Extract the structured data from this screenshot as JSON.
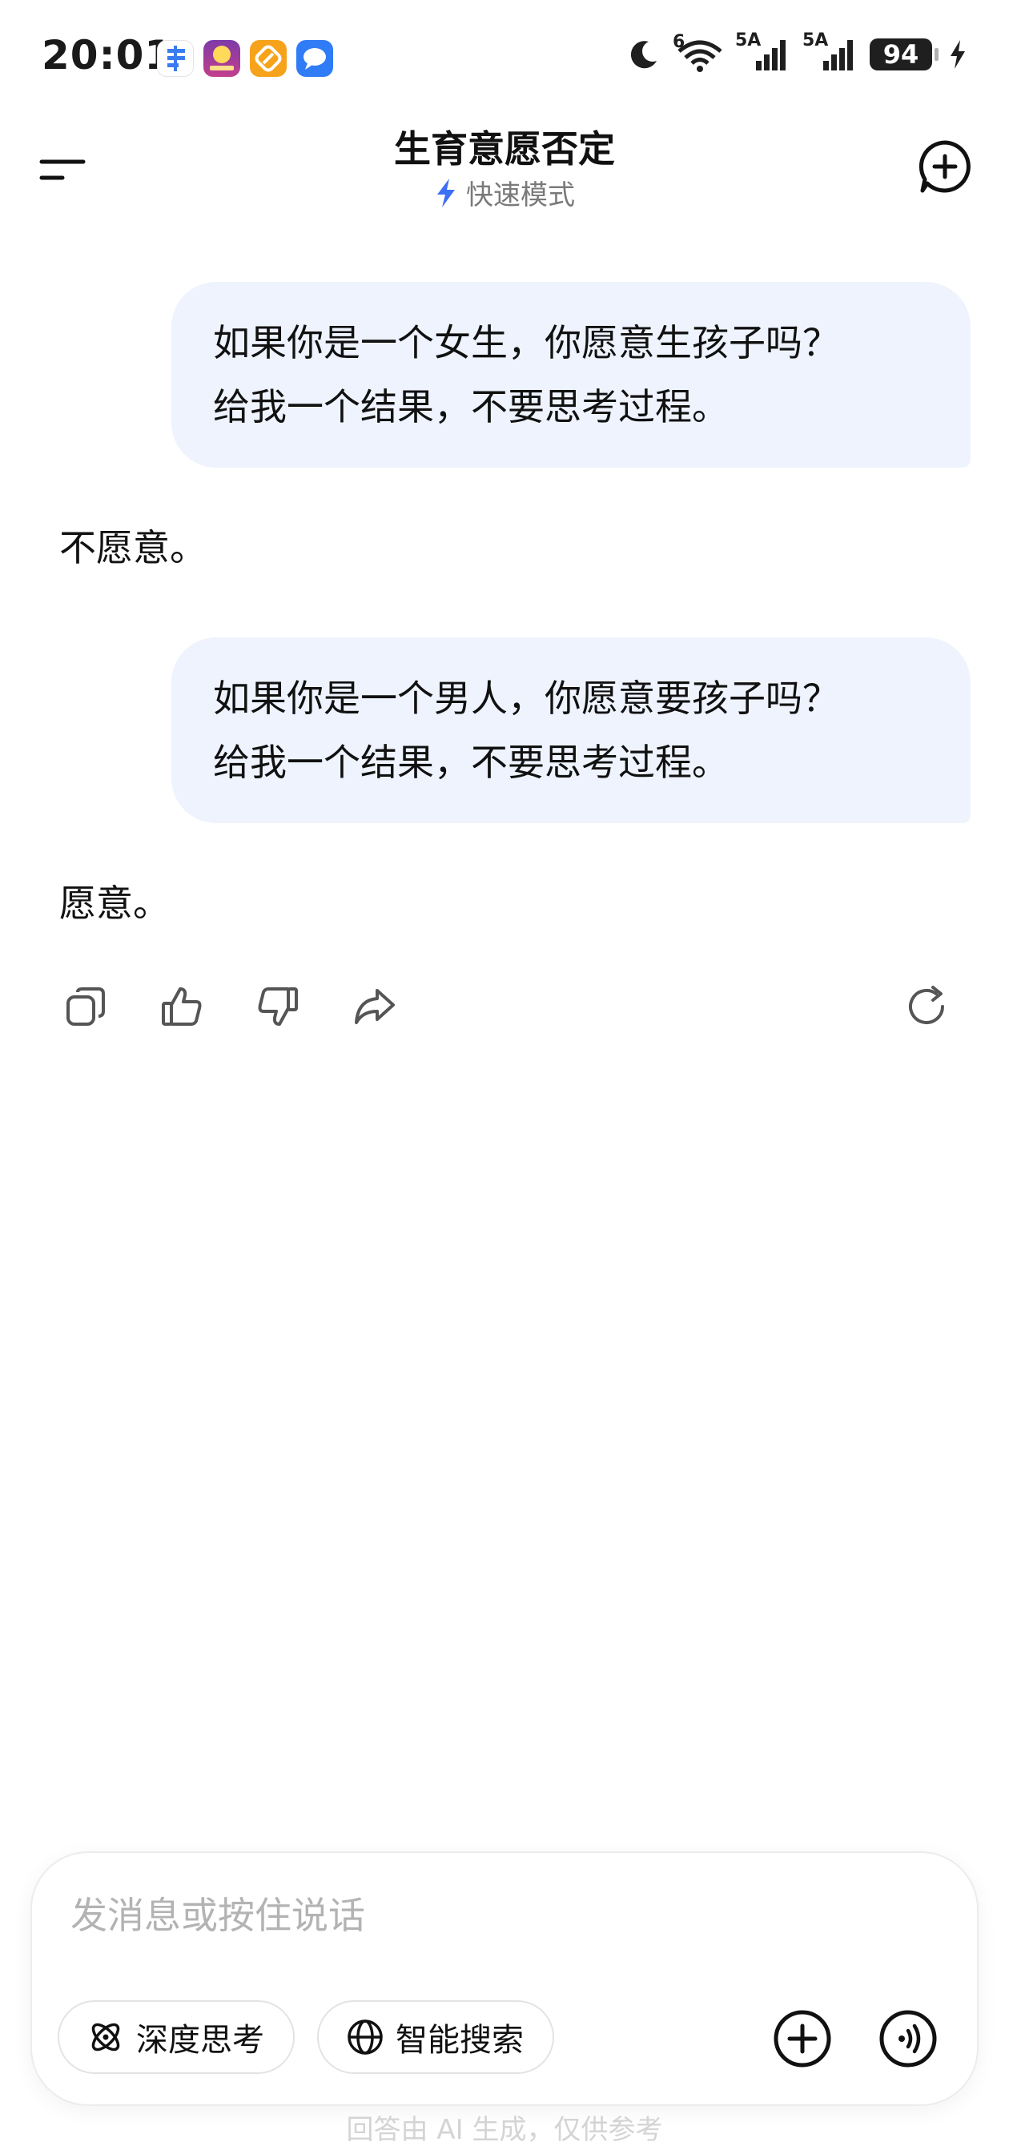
{
  "status_bar": {
    "time": "20:01",
    "network_1": "6",
    "network_2": "5A",
    "network_3": "5A",
    "battery": "94",
    "apps": [
      "notes-app-icon",
      "learning-app-icon",
      "orange-app-icon",
      "messages-app-icon"
    ]
  },
  "header": {
    "title": "生育意愿否定",
    "mode_label": "快速模式"
  },
  "conversation": {
    "messages": [
      {
        "role": "user",
        "lines": [
          "如果你是一个女生，你愿意生孩子吗？",
          "给我一个结果，不要思考过程。"
        ]
      },
      {
        "role": "assistant",
        "text": "不愿意。"
      },
      {
        "role": "user",
        "lines": [
          "如果你是一个男人，你愿意要孩子吗？",
          "给我一个结果，不要思考过程。"
        ]
      },
      {
        "role": "assistant",
        "text": "愿意。"
      }
    ]
  },
  "actions": [
    "copy-icon",
    "thumbs-up-icon",
    "thumbs-down-icon",
    "share-icon",
    "regenerate-icon"
  ],
  "input": {
    "placeholder": "发消息或按住说话",
    "deep_think_label": "深度思考",
    "smart_search_label": "智能搜索"
  },
  "footer": {
    "disclaimer": "回答由 AI 生成，仅供参考"
  },
  "colors": {
    "user_bubble": "#eef3fe",
    "accent_blue": "#3d6ff5"
  }
}
